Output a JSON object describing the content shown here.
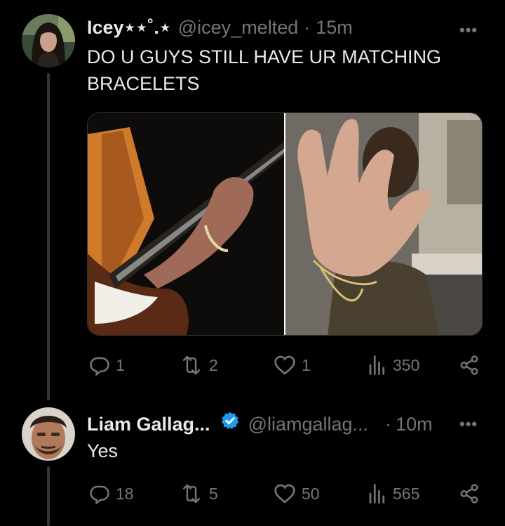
{
  "tweet1": {
    "display_name": "Icey⋆⋆˚.⋆",
    "handle": "@icey_melted",
    "separator": "·",
    "time": "15m",
    "text_line1": "DO U GUYS STILL HAVE UR MATCHING",
    "text_line2": "BRACELETS",
    "actions": {
      "replies": "1",
      "reposts": "2",
      "likes": "1",
      "views": "350"
    }
  },
  "tweet2": {
    "display_name": "Liam Gallag...",
    "handle": "@liamgallag...",
    "separator": "·",
    "time": "10m",
    "text": "Yes",
    "actions": {
      "replies": "18",
      "reposts": "5",
      "likes": "50",
      "views": "565"
    }
  },
  "more_label": "•••",
  "icons": [
    "reply-icon",
    "repost-icon",
    "like-icon",
    "views-icon",
    "share-icon",
    "verified-badge-icon",
    "more-icon"
  ],
  "colors": {
    "background": "#000000",
    "text": "#e7e9ea",
    "secondary": "#71767b",
    "verified": "#1d9bf0",
    "thread_line": "#333639"
  }
}
